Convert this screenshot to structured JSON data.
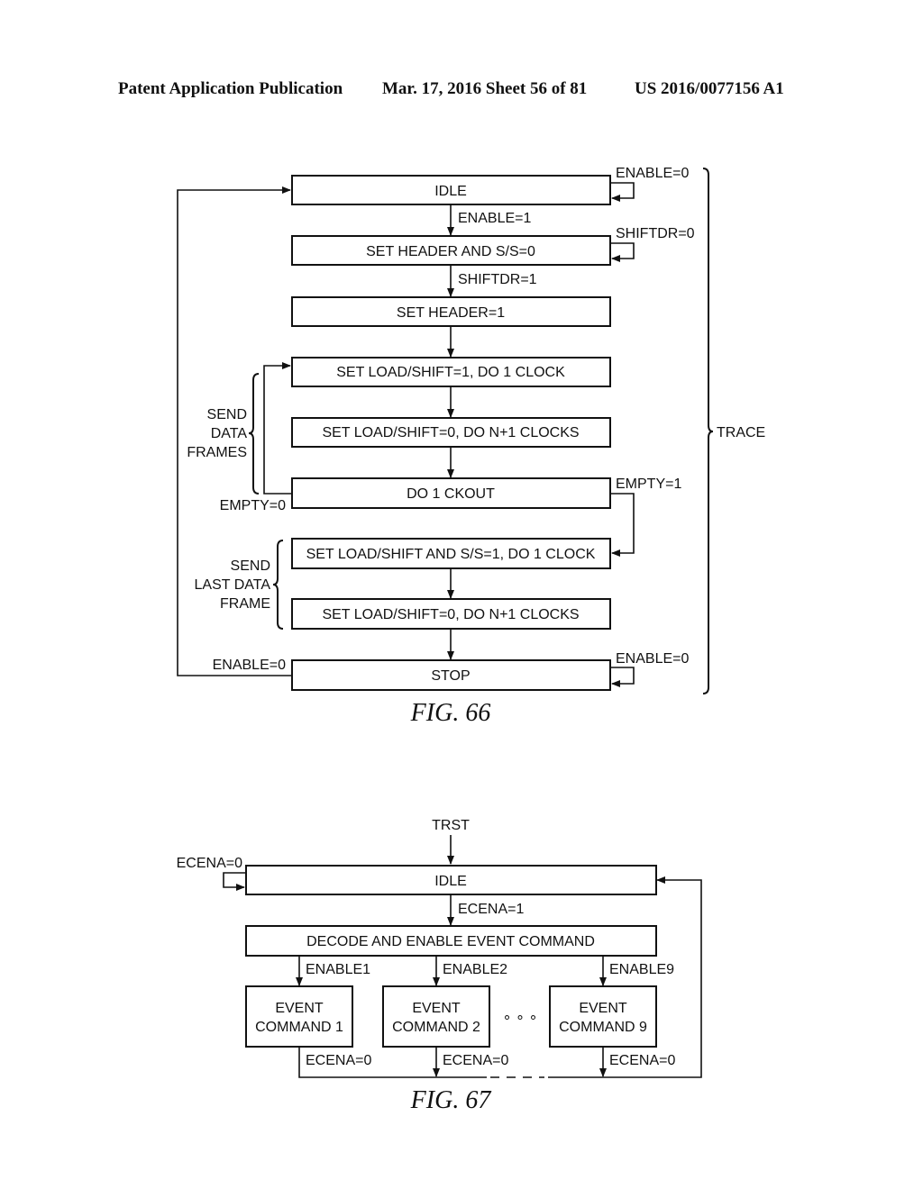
{
  "header": {
    "left": "Patent Application Publication",
    "center": "Mar. 17, 2016  Sheet 56 of 81",
    "right": "US 2016/0077156 A1"
  },
  "fig66": {
    "caption": "FIG. 66",
    "states": {
      "idle": "IDLE",
      "set_header_ss0": "SET HEADER AND S/S=0",
      "set_header1": "SET HEADER=1",
      "load_shift1": "SET LOAD/SHIFT=1, DO 1 CLOCK",
      "load_shift0_a": "SET LOAD/SHIFT=0, DO N+1 CLOCKS",
      "do_ckout": "DO 1 CKOUT",
      "load_shift_ss1": "SET LOAD/SHIFT AND S/S=1, DO 1 CLOCK",
      "load_shift0_b": "SET LOAD/SHIFT=0, DO N+1 CLOCKS",
      "stop": "STOP"
    },
    "transitions": {
      "idle_self": "ENABLE=0",
      "idle_to_header": "ENABLE=1",
      "header_self": "SHIFTDR=0",
      "header_to_header1": "SHIFTDR=1",
      "empty0": "EMPTY=0",
      "empty1": "EMPTY=1",
      "stop_to_idle": "ENABLE=0",
      "stop_self": "ENABLE=0"
    },
    "braces": {
      "send_data_frames": [
        "SEND",
        "DATA",
        "FRAMES"
      ],
      "send_last_data_frame": [
        "SEND",
        "LAST DATA",
        "FRAME"
      ],
      "trace": "TRACE"
    }
  },
  "fig67": {
    "caption": "FIG. 67",
    "input": "TRST",
    "states": {
      "idle": "IDLE",
      "decode": "DECODE AND ENABLE EVENT COMMAND",
      "event1": [
        "EVENT",
        "COMMAND 1"
      ],
      "event2": [
        "EVENT",
        "COMMAND 2"
      ],
      "event9": [
        "EVENT",
        "COMMAND 9"
      ],
      "ellipsis": "∘ ∘ ∘"
    },
    "transitions": {
      "idle_self": "ECENA=0",
      "idle_to_decode": "ECENA=1",
      "enable1": "ENABLE1",
      "enable2": "ENABLE2",
      "enable9": "ENABLE9",
      "ecena0_1": "ECENA=0",
      "ecena0_2": "ECENA=0",
      "ecena0_9": "ECENA=0"
    }
  }
}
